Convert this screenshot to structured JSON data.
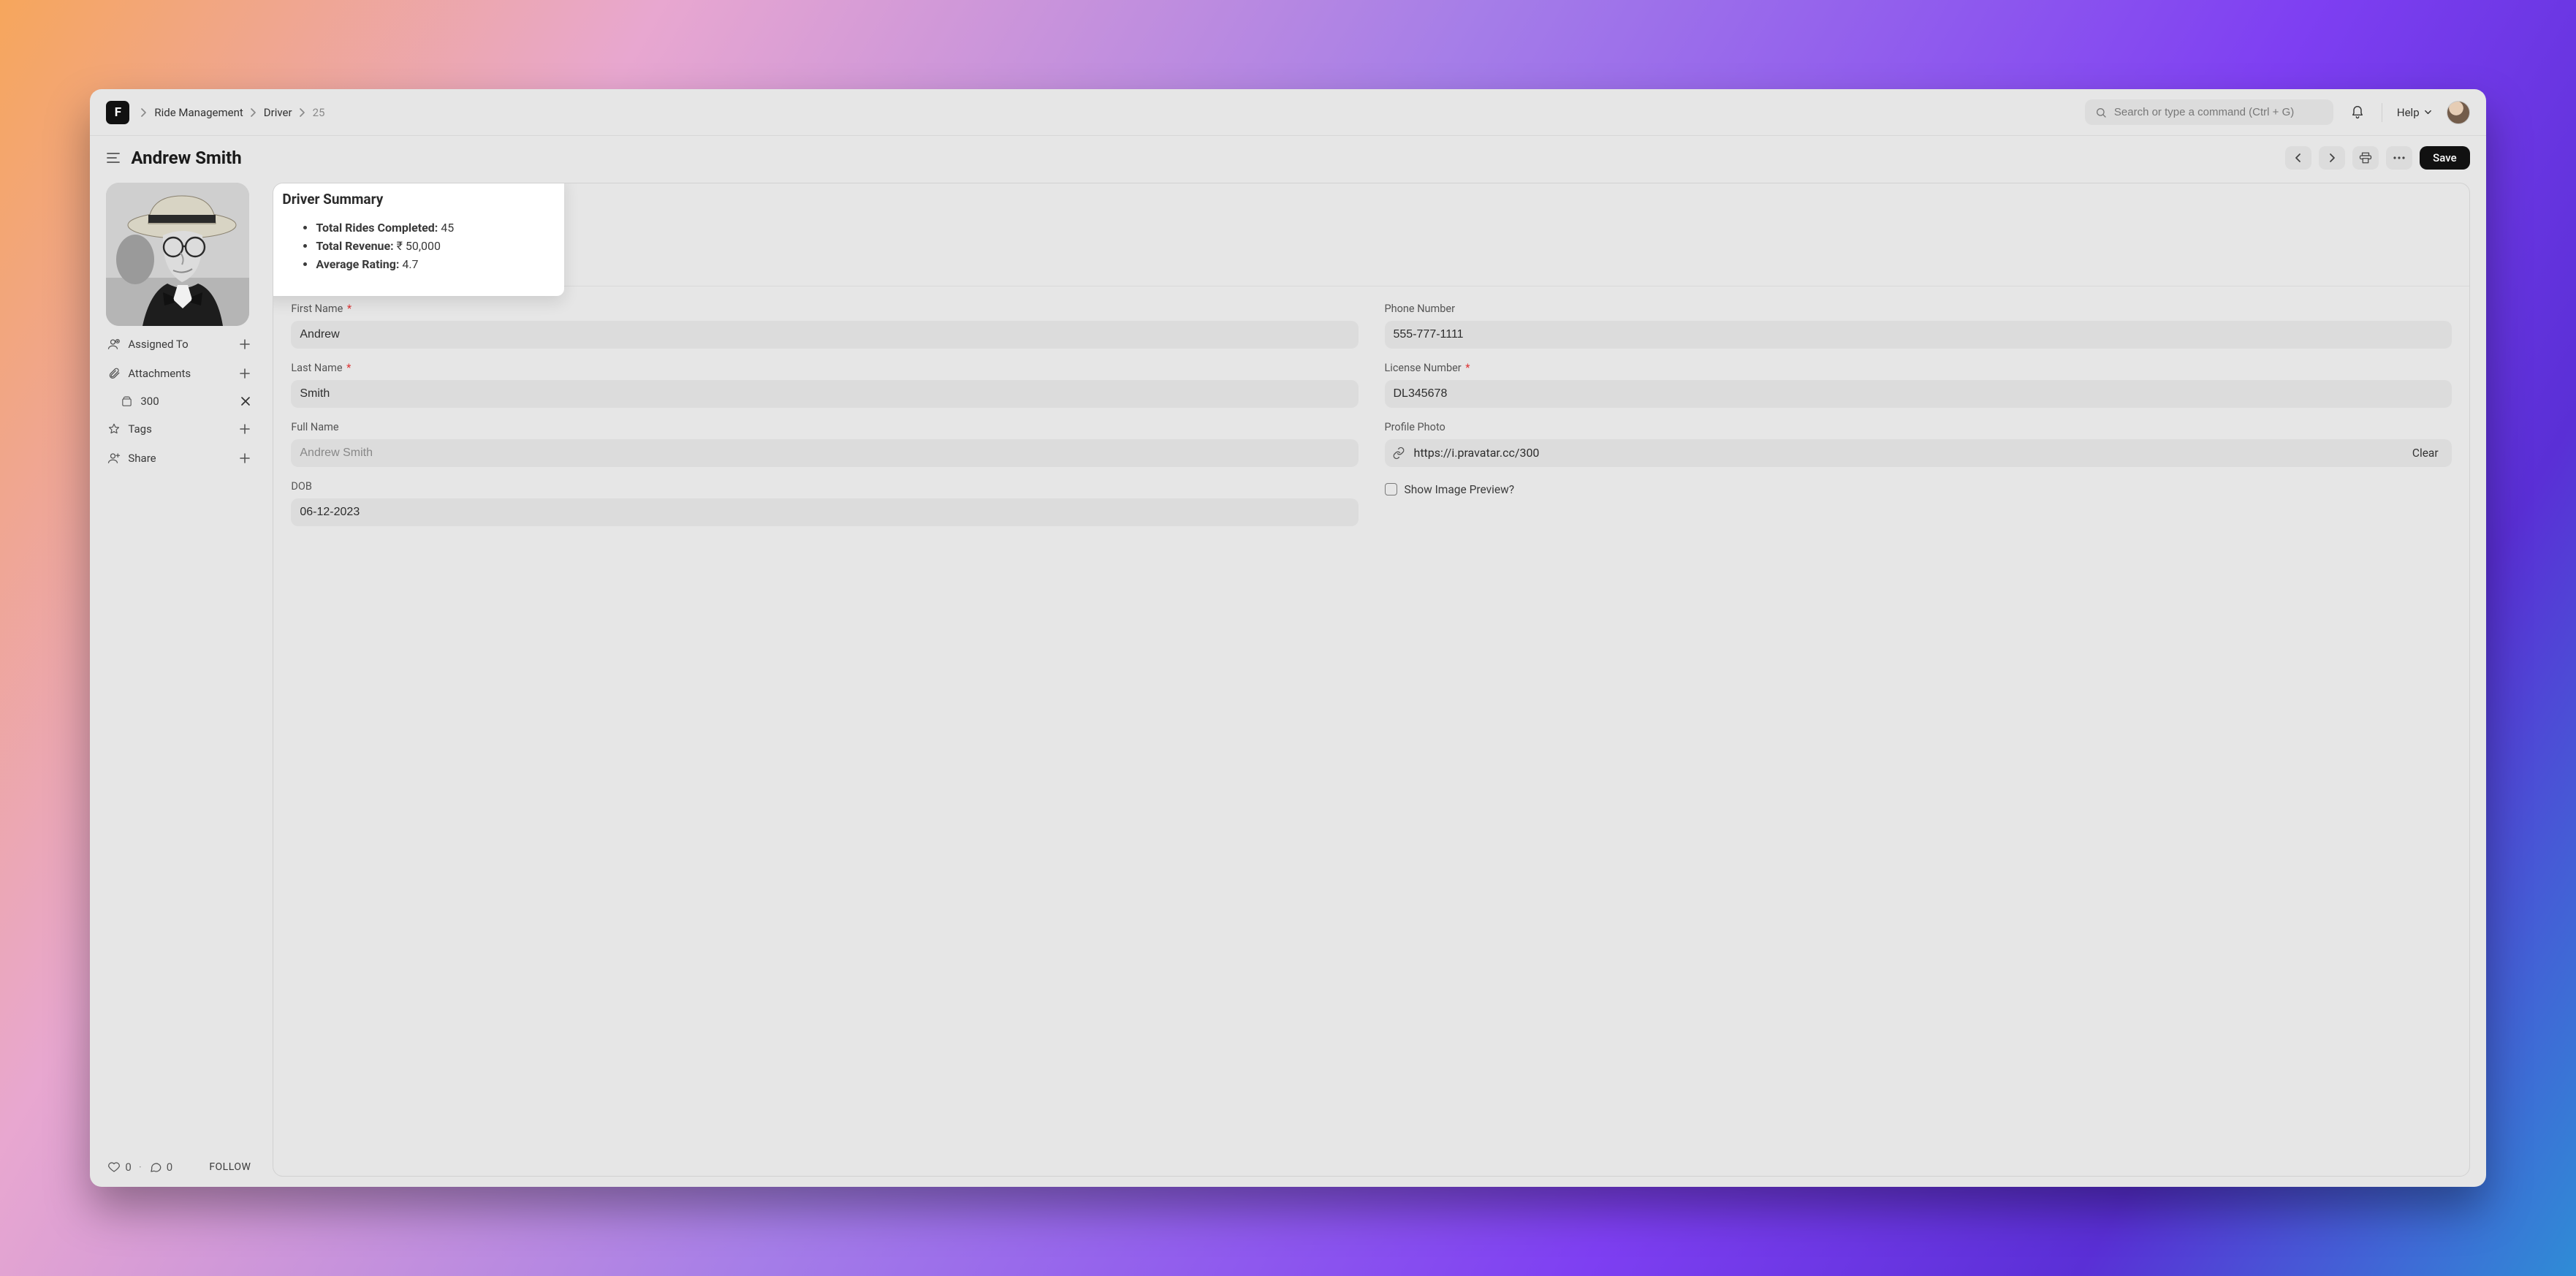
{
  "breadcrumbs": {
    "item1": "Ride Management",
    "item2": "Driver",
    "item3": "25"
  },
  "search": {
    "placeholder": "Search or type a command (Ctrl + G)"
  },
  "help_label": "Help",
  "page_title": "Andrew Smith",
  "save_label": "Save",
  "sidebar": {
    "assigned_to": "Assigned To",
    "attachments": "Attachments",
    "attachment_items": [
      "300"
    ],
    "tags": "Tags",
    "share": "Share",
    "likes": "0",
    "comments": "0",
    "follow": "FOLLOW"
  },
  "summary": {
    "title": "Driver Summary",
    "rides_label": "Total Rides Completed:",
    "rides_value": "45",
    "revenue_label": "Total Revenue:",
    "revenue_value": "₹ 50,000",
    "rating_label": "Average Rating:",
    "rating_value": "4.7"
  },
  "form": {
    "first_name": {
      "label": "First Name",
      "value": "Andrew"
    },
    "last_name": {
      "label": "Last Name",
      "value": "Smith"
    },
    "full_name": {
      "label": "Full Name",
      "placeholder": "Andrew Smith"
    },
    "dob": {
      "label": "DOB",
      "value": "06-12-2023"
    },
    "phone": {
      "label": "Phone Number",
      "value": "555-777-1111"
    },
    "license": {
      "label": "License Number",
      "value": "DL345678"
    },
    "photo": {
      "label": "Profile Photo",
      "value": "https://i.pravatar.cc/300",
      "clear": "Clear"
    },
    "show_preview": {
      "label": "Show Image Preview?"
    }
  }
}
